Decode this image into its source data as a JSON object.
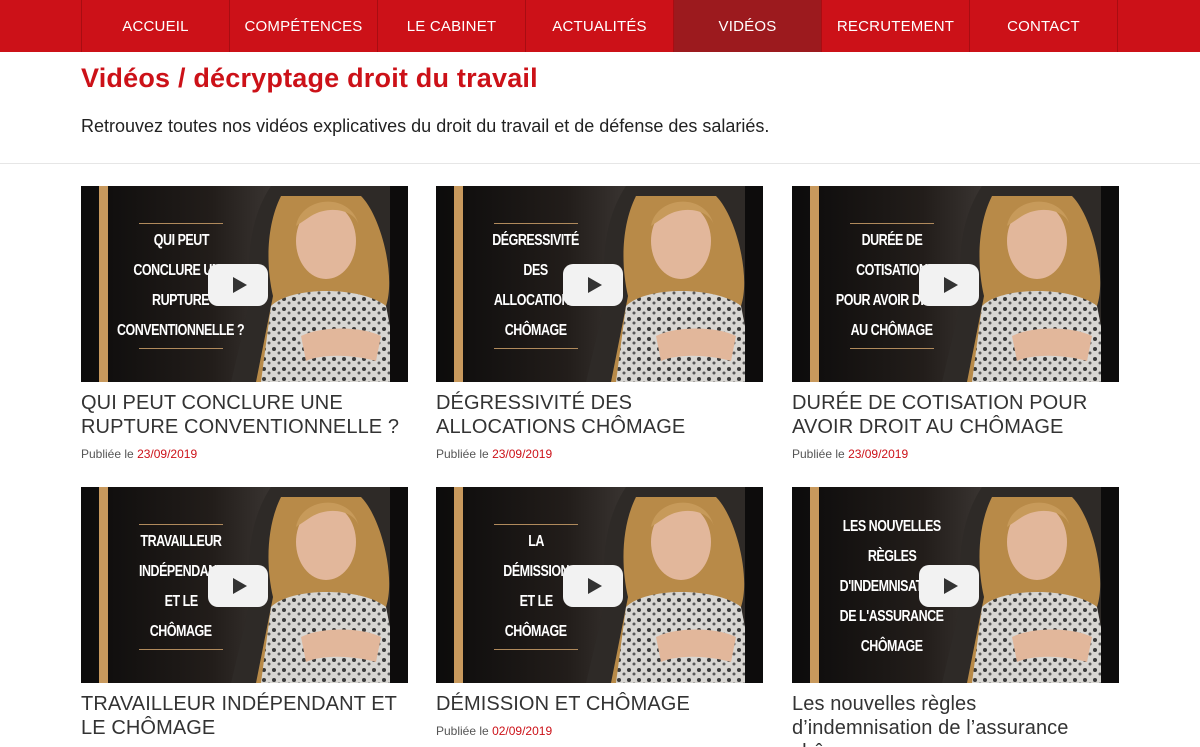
{
  "nav": {
    "items": [
      {
        "label": "ACCUEIL",
        "active": false
      },
      {
        "label": "COMPÉTENCES",
        "active": false
      },
      {
        "label": "LE CABINET",
        "active": false
      },
      {
        "label": "ACTUALITÉS",
        "active": false
      },
      {
        "label": "VIDÉOS",
        "active": true
      },
      {
        "label": "RECRUTEMENT",
        "active": false
      },
      {
        "label": "CONTACT",
        "active": false
      }
    ]
  },
  "page": {
    "title": "Vidéos / décryptage droit du travail",
    "intro": "Retrouvez toutes nos vidéos explicatives du droit du travail et de défense des salariés."
  },
  "videos": [
    {
      "thumb_lines": [
        "QUI PEUT",
        "CONCLURE UNE",
        "RUPTURE",
        "CONVENTIONNELLE ?"
      ],
      "title": "QUI PEUT CONCLURE UNE RUPTURE CONVENTIONNELLE ?",
      "published_label": "Publiée le",
      "date": "23/09/2019"
    },
    {
      "thumb_lines": [
        "DÉGRESSIVITÉ",
        "DES",
        "ALLOCATIONS",
        "CHÔMAGE"
      ],
      "title": "DÉGRESSIVITÉ DES ALLOCATIONS CHÔMAGE",
      "published_label": "Publiée le",
      "date": "23/09/2019"
    },
    {
      "thumb_lines": [
        "DURÉE DE",
        "COTISATION",
        "POUR AVOIR DROIT",
        "AU CHÔMAGE"
      ],
      "title": "DURÉE DE COTISATION POUR AVOIR DROIT AU CHÔMAGE",
      "published_label": "Publiée le",
      "date": "23/09/2019"
    },
    {
      "thumb_lines": [
        "TRAVAILLEUR",
        "INDÉPENDANT",
        "ET LE",
        "CHÔMAGE"
      ],
      "title": "TRAVAILLEUR INDÉPENDANT ET LE CHÔMAGE",
      "published_label": "",
      "date": ""
    },
    {
      "thumb_lines": [
        "LA",
        "DÉMISSION",
        "ET LE",
        "CHÔMAGE"
      ],
      "title": "DÉMISSION ET CHÔMAGE",
      "published_label": "Publiée le",
      "date": "02/09/2019"
    },
    {
      "thumb_lines": [
        "LES NOUVELLES",
        "RÈGLES",
        "D'INDEMNISATION",
        "DE L'ASSURANCE",
        "CHÔMAGE"
      ],
      "title": "Les nouvelles règles d’indemnisation de l’assurance chômage",
      "published_label": "",
      "date": ""
    }
  ],
  "colors": {
    "brand_red": "#cc1118",
    "nav_active": "#9c1a1e",
    "accent_gold": "#c8995d"
  }
}
